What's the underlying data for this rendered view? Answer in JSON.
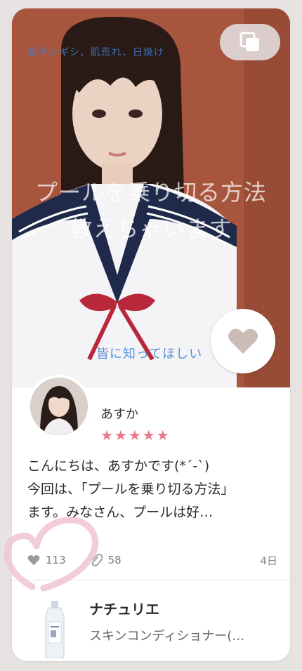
{
  "hero": {
    "tags": "髪ギシギシ、肌荒れ、日焼け",
    "title_line1": "プールを乗り切る方法",
    "title_line2": "教えちゃいます",
    "subtitle": "皆に知ってほしい",
    "icons": {
      "multi": "copy-icon",
      "like": "heart-icon"
    }
  },
  "author": {
    "name": "あすか",
    "rating": 5,
    "stars": "★★★★★"
  },
  "post": {
    "line1": "こんにちは、あすかです(*´-`)",
    "line2": "今回は、「プールを乗り切る方法」",
    "line3": "ます。みなさん、プールは好…"
  },
  "stats": {
    "likes": "113",
    "clips": "58",
    "date": "4日"
  },
  "product": {
    "brand": "ナチュリエ",
    "name": "スキンコンディショナー(…"
  },
  "colors": {
    "star": "#e8798f",
    "background": "#e7e3e3",
    "heart_fab": "#cbbcb6",
    "annotation": "#f2c6d6"
  }
}
